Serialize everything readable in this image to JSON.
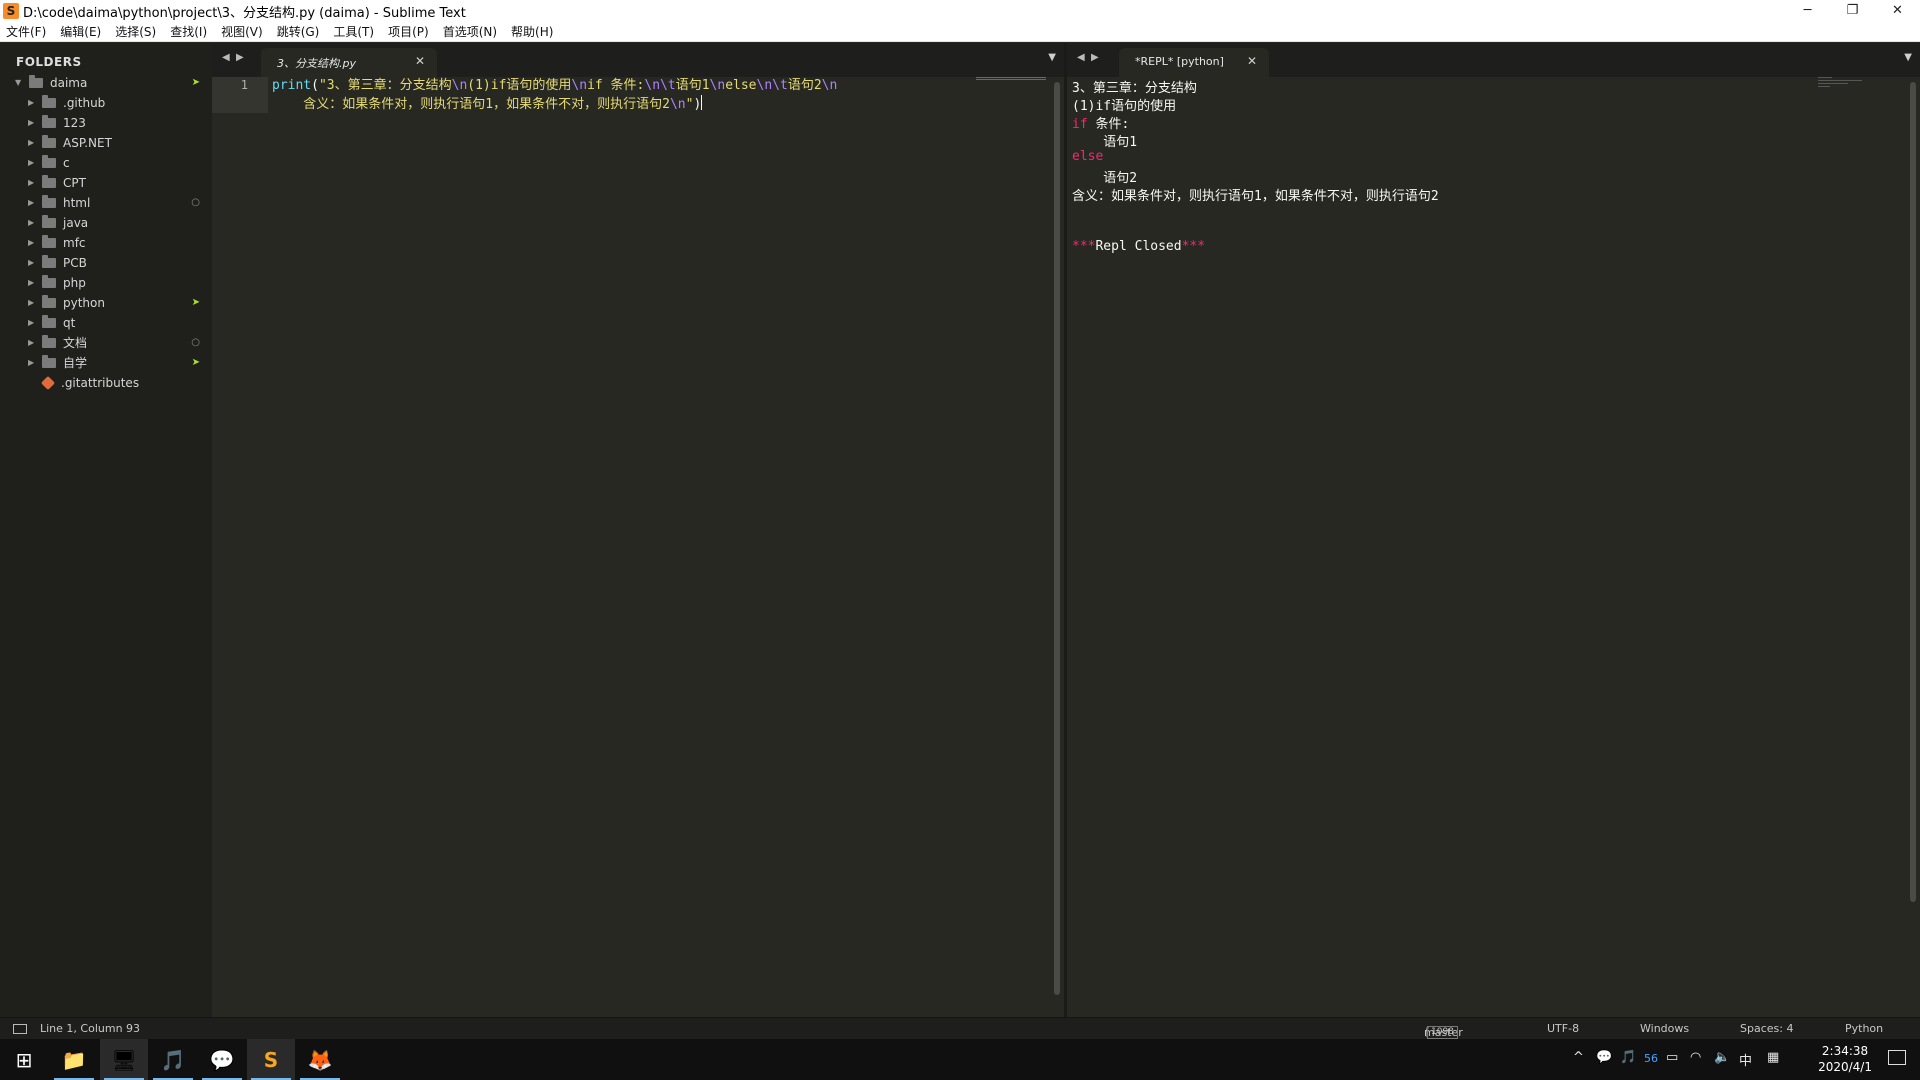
{
  "window": {
    "title": "D:\\code\\daima\\python\\project\\3、分支结构.py (daima) - Sublime Text",
    "controls": {
      "minimize": "─",
      "restore": "❐",
      "close": "✕"
    }
  },
  "menu": [
    "文件(F)",
    "编辑(E)",
    "选择(S)",
    "查找(I)",
    "视图(V)",
    "跳转(G)",
    "工具(T)",
    "项目(P)",
    "首选项(N)",
    "帮助(H)"
  ],
  "sidebar": {
    "title": "FOLDERS",
    "root": {
      "label": "daima",
      "badge": "➤"
    },
    "items": [
      {
        "label": ".github",
        "badge": ""
      },
      {
        "label": "123",
        "badge": ""
      },
      {
        "label": "ASP.NET",
        "badge": ""
      },
      {
        "label": "c",
        "badge": ""
      },
      {
        "label": "CPT",
        "badge": ""
      },
      {
        "label": "html",
        "badge": "○"
      },
      {
        "label": "java",
        "badge": ""
      },
      {
        "label": "mfc",
        "badge": ""
      },
      {
        "label": "PCB",
        "badge": ""
      },
      {
        "label": "php",
        "badge": ""
      },
      {
        "label": "python",
        "badge": "➤"
      },
      {
        "label": "qt",
        "badge": ""
      },
      {
        "label": "文档",
        "badge": "○"
      },
      {
        "label": "自学",
        "badge": "➤"
      }
    ],
    "file": {
      "label": ".gitattributes"
    }
  },
  "left_pane": {
    "tab": {
      "label": "3、分支结构.py",
      "close": "✕"
    },
    "nav": {
      "prev": "◀",
      "next": "▶",
      "dropdown": "▼"
    },
    "line_number": "1",
    "code": {
      "fn": "print",
      "open": "(",
      "s1": "\"3、第三章：分支结构",
      "e1": "\\n",
      "s2": "(1)if语句的使用",
      "e2": "\\n",
      "s3": "if 条件:",
      "e3": "\\n\\t",
      "s4": "语句1",
      "e4": "\\n",
      "s5": "else",
      "e5": "\\n\\t",
      "s6": "语句2",
      "e6": "\\n",
      "s7": "    含义：如果条件对，则执行语句1，如果条件不对，则执行语句2",
      "e7": "\\n",
      "s8": "\"",
      "close": ")"
    }
  },
  "right_pane": {
    "tab": {
      "label": "*REPL* [python]",
      "close": "✕"
    },
    "nav": {
      "prev": "◀",
      "next": "▶",
      "dropdown": "▼"
    },
    "output": {
      "l1": "3、第三章：分支结构",
      "l2": "(1)if语句的使用",
      "l3_kw": "if",
      "l3_rest": " 条件:",
      "l4": "    语句1",
      "l5_kw": "else",
      "l6": "    语句2",
      "l7": "含义：如果条件对，则执行语句1，如果条件不对，则执行语句2",
      "closed_stars_open": "***",
      "closed_text": "Repl Closed",
      "closed_stars_close": "***"
    }
  },
  "statusbar": {
    "position": "Line 1, Column 93",
    "branch": "master",
    "branch_count": "1098",
    "encoding": "UTF-8",
    "line_endings": "Windows",
    "indent": "Spaces: 4",
    "syntax": "Python"
  },
  "taskbar": {
    "apps": [
      {
        "name": "start",
        "glyph": "⊞"
      },
      {
        "name": "file-explorer",
        "glyph": "📁"
      },
      {
        "name": "app-blue",
        "glyph": "🖥"
      },
      {
        "name": "netease-music",
        "glyph": "🎵"
      },
      {
        "name": "wechat",
        "glyph": "💬"
      },
      {
        "name": "sublime-text",
        "glyph": "S"
      },
      {
        "name": "firefox",
        "glyph": "🦊"
      }
    ],
    "tray": {
      "chevron": "^",
      "num": "56",
      "ime": "中",
      "grid": "▦"
    },
    "clock": {
      "time": "2:34:38",
      "date": "2020/4/1"
    }
  },
  "colors": {
    "editor_bg": "#272822",
    "sidebar_bg": "#1f201b",
    "string": "#e6db74",
    "escape": "#ae81ff",
    "function": "#66d9ef",
    "keyword": "#f92672",
    "vcs_badge": "#a6e22e"
  }
}
